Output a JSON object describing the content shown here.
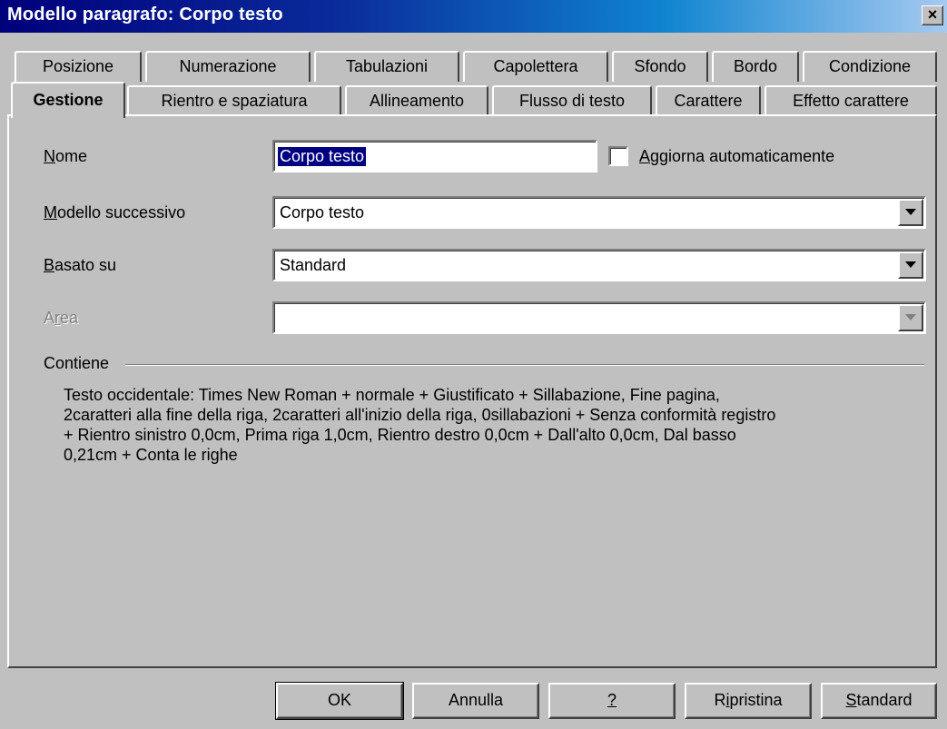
{
  "window": {
    "title": "Modello paragrafo: Corpo testo",
    "close_label": "×"
  },
  "tabs_row1": [
    {
      "label": "Posizione"
    },
    {
      "label": "Numerazione"
    },
    {
      "label": "Tabulazioni"
    },
    {
      "label": "Capolettera"
    },
    {
      "label": "Sfondo"
    },
    {
      "label": "Bordo"
    },
    {
      "label": "Condizione"
    }
  ],
  "tabs_row2": [
    {
      "label": "Gestione",
      "active": true
    },
    {
      "label": "Rientro e spaziatura"
    },
    {
      "label": "Allineamento"
    },
    {
      "label": "Flusso di testo"
    },
    {
      "label": "Carattere"
    },
    {
      "label": "Effetto carattere"
    }
  ],
  "form": {
    "name": {
      "label_u": "N",
      "label_rest": "ome",
      "value": "Corpo testo"
    },
    "auto_update": {
      "label_u": "A",
      "label_rest": "ggiorna automaticamente",
      "checked": false
    },
    "next_style": {
      "label_u": "M",
      "label_rest": "odello successivo",
      "value": "Corpo testo"
    },
    "based_on": {
      "label_u": "B",
      "label_rest": "asato su",
      "value": "Standard"
    },
    "area": {
      "label_pre": "A",
      "label_u": "r",
      "label_rest": "ea",
      "value": "",
      "disabled": true
    }
  },
  "contains": {
    "label": "Contiene",
    "lines": [
      "Testo occidentale: Times New Roman + normale + Giustificato + Sillabazione, Fine pagina,",
      "2caratteri alla fine della riga, 2caratteri all'inizio della riga, 0sillabazioni + Senza conformità registro",
      "+ Rientro sinistro  0,0cm, Prima riga  1,0cm, Rientro destro  0,0cm + Dall'alto  0,0cm, Dal basso",
      "0,21cm + Conta le righe"
    ]
  },
  "buttons": {
    "ok": {
      "label": "OK"
    },
    "cancel": {
      "label": "Annulla"
    },
    "help": {
      "label": "?"
    },
    "reset_pre": "R",
    "reset_u": "i",
    "reset_rest": "pristina",
    "standard_u": "S",
    "standard_rest": "tandard"
  },
  "colors": {
    "face": "#c0c0c0",
    "title_start": "#00007b",
    "title_end": "#a6caf0",
    "selection": "#000080"
  }
}
